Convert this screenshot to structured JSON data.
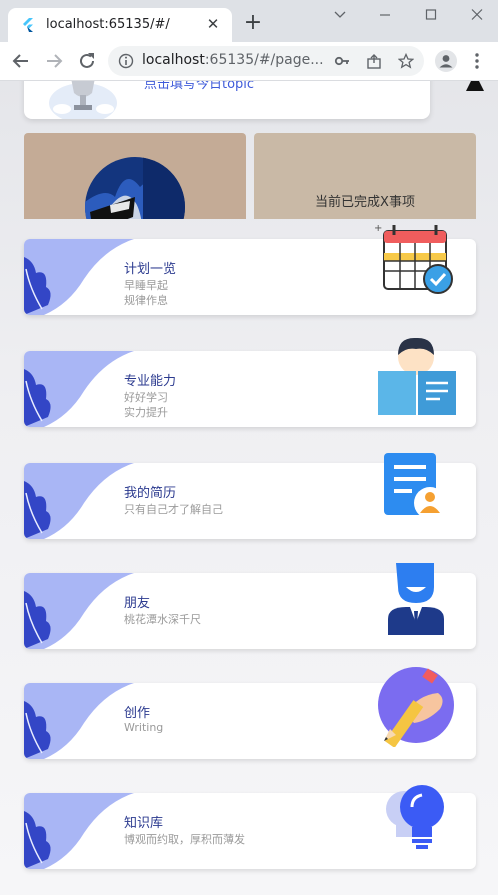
{
  "browser": {
    "tab_title": "localhost:65135/#/",
    "url_host": "localhost",
    "url_rest": ":65135/#/page..."
  },
  "page": {
    "topic_prompt": "点击填写今日topic",
    "status_text": "当前已完成X事项",
    "menu": [
      {
        "title": "计划一览",
        "sub1": "早睡早起",
        "sub2": "规律作息",
        "icon": "calendar-icon"
      },
      {
        "title": "专业能力",
        "sub1": "好好学习",
        "sub2": "实力提升",
        "icon": "reading-student-icon"
      },
      {
        "title": "我的简历",
        "sub1": "只有自己才了解自己",
        "sub2": "",
        "icon": "resume-icon"
      },
      {
        "title": "朋友",
        "sub1": "桃花潭水深千尺",
        "sub2": "",
        "icon": "friend-person-icon"
      },
      {
        "title": "创作",
        "sub1": "Writing",
        "sub2": "",
        "icon": "pencil-hand-icon"
      },
      {
        "title": "知识库",
        "sub1": "博观而约取，厚积而薄发",
        "sub2": "",
        "icon": "lightbulb-icon"
      }
    ]
  },
  "colors": {
    "accent": "#3f5bd9",
    "deco_light": "#a9b6f5",
    "deco_dark": "#3346c6"
  }
}
